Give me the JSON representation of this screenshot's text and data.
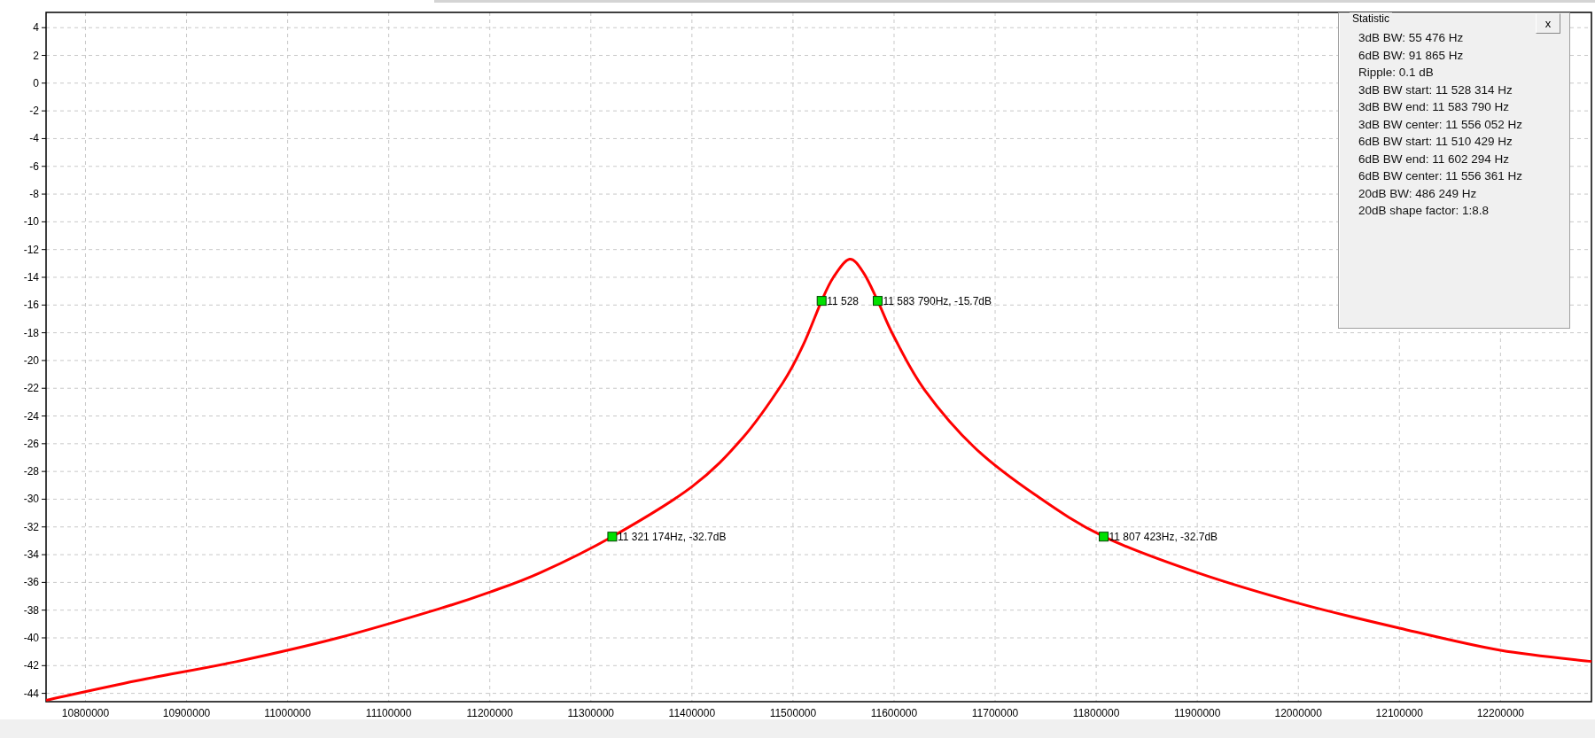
{
  "chart": {
    "chart_data": {
      "type": "line",
      "x": [
        10761000,
        10850000,
        10950000,
        11050000,
        11150000,
        11200000,
        11250000,
        11321174,
        11400000,
        11450000,
        11490000,
        11510000,
        11528314,
        11540000,
        11556000,
        11570000,
        11583790,
        11600000,
        11630000,
        11680000,
        11740000,
        11807423,
        11900000,
        12000000,
        12100000,
        12200000,
        12290000
      ],
      "series": [
        {
          "color": "#ff0000",
          "values": [
            -44.5,
            -43.1,
            -41.7,
            -40.0,
            -37.9,
            -36.7,
            -35.3,
            -32.7,
            -29.1,
            -25.6,
            -21.6,
            -18.9,
            -15.7,
            -14.0,
            -12.7,
            -13.7,
            -15.7,
            -18.3,
            -22.1,
            -26.3,
            -29.7,
            -32.7,
            -35.3,
            -37.5,
            -39.3,
            -40.9,
            -41.7
          ]
        }
      ],
      "xlim": [
        10761000,
        12290000
      ],
      "ylim": [
        -44.6,
        5.1
      ],
      "grid": true,
      "xticks": [
        10800000,
        10900000,
        11000000,
        11100000,
        11200000,
        11300000,
        11400000,
        11500000,
        11600000,
        11700000,
        11800000,
        11900000,
        12000000,
        12100000,
        12200000
      ],
      "yticks": [
        4,
        2,
        0,
        -2,
        -4,
        -6,
        -8,
        -10,
        -12,
        -14,
        -16,
        -18,
        -20,
        -22,
        -24,
        -26,
        -28,
        -30,
        -32,
        -34,
        -36,
        -38,
        -40,
        -42,
        -44
      ],
      "annotations": [
        {
          "x": 11321174,
          "y": -32.7,
          "text": "11 321 174Hz, -32.7dB"
        },
        {
          "x": 11807423,
          "y": -32.7,
          "text": "11 807 423Hz, -32.7dB"
        },
        {
          "x": 11528314,
          "y": -15.7,
          "text": "11 528"
        },
        {
          "x": 11583790,
          "y": -15.7,
          "text": "11 583 790Hz, -15.7dB"
        }
      ]
    }
  },
  "statistic": {
    "title": "Statistic",
    "close": "x",
    "lines": [
      "3dB BW: 55 476 Hz",
      "6dB BW: 91 865 Hz",
      "Ripple: 0.1 dB",
      "3dB BW start: 11 528 314 Hz",
      "3dB BW end: 11 583 790 Hz",
      "3dB BW center: 11 556 052 Hz",
      "6dB BW start: 11 510 429 Hz",
      "6dB BW end: 11 602 294 Hz",
      "6dB BW center: 11 556 361 Hz",
      "20dB BW: 486 249 Hz",
      "20dB shape factor: 1:8.8"
    ]
  }
}
